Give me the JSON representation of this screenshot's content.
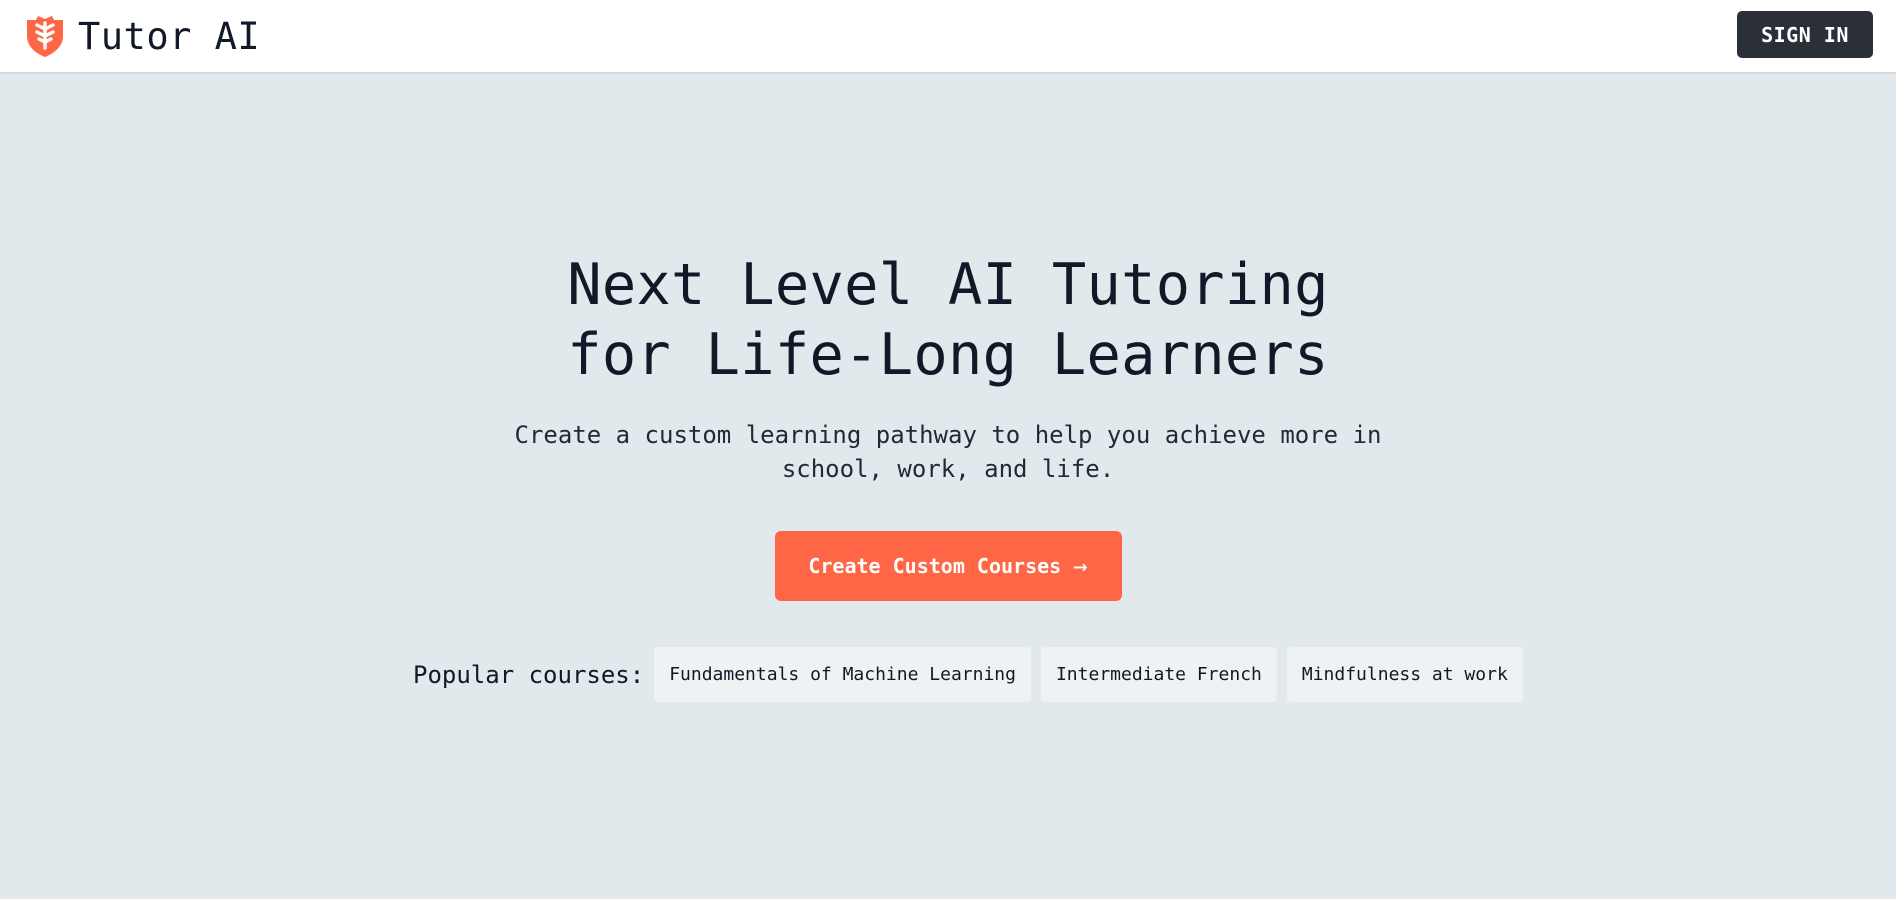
{
  "brand": {
    "name": "Tutor AI",
    "icon": "shield-tree-logo-icon",
    "color": "#ff6645"
  },
  "header": {
    "sign_in_label": "SIGN IN"
  },
  "hero": {
    "headline_line1": "Next Level AI Tutoring",
    "headline_line2": "for Life-Long Learners",
    "subtitle": "Create a custom learning pathway to help you achieve more in school, work, and life.",
    "cta_label": "Create Custom Courses",
    "cta_icon": "arrow-right-icon",
    "cta_color": "#ff6645"
  },
  "popular": {
    "label": "Popular courses:",
    "courses": [
      "Fundamentals of Machine Learning",
      "Intermediate French",
      "Mindfulness at work"
    ]
  },
  "colors": {
    "background": "#e2e9ec",
    "header_background": "#ffffff",
    "sign_in_background": "#2b3038",
    "chip_background": "#eef2f4"
  }
}
